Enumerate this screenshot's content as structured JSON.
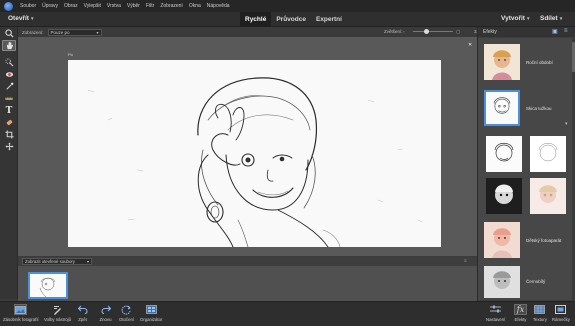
{
  "menubar": {
    "items": [
      "Soubor",
      "Úpravy",
      "Obraz",
      "Vylepšit",
      "Vrstva",
      "Výběr",
      "Filtr",
      "Zobrazení",
      "Okna",
      "Nápověda"
    ]
  },
  "modebar": {
    "open_label": "Otevřít",
    "modes": [
      "Rychlé",
      "Průvodce",
      "Expertní"
    ],
    "active_mode": "Rychlé",
    "create_label": "Vytvořit",
    "share_label": "Sdílet"
  },
  "options": {
    "view_label": "Zobrazení:",
    "view_value": "Pouze po",
    "zoom_label": "Zvětšení:",
    "zoom_value": "33%",
    "zoom_level": 0.3
  },
  "toolbox": {
    "tools": [
      "zoom-icon",
      "hand-icon",
      "quick-selection-icon",
      "red-eye-icon",
      "whiten-teeth-icon",
      "straighten-icon",
      "text-icon",
      "spot-healing-icon",
      "crop-icon",
      "move-icon"
    ],
    "active": "hand-icon"
  },
  "document": {
    "label": "Po",
    "close_glyph": "✕"
  },
  "photobin": {
    "select_value": "Zobrazit otevřené soubory"
  },
  "taskbar": {
    "left": [
      {
        "label": "Zásobník fotografií",
        "icon": "photo-bin-icon"
      },
      {
        "label": "Volby nástrojů",
        "icon": "tool-options-icon"
      },
      {
        "label": "Zpět",
        "icon": "undo-icon"
      },
      {
        "label": "Znovu",
        "icon": "redo-icon"
      },
      {
        "label": "Otočení",
        "icon": "rotate-icon"
      },
      {
        "label": "Organizátor",
        "icon": "organizer-icon"
      }
    ],
    "right": [
      {
        "label": "Nastavení",
        "icon": "adjustments-icon"
      },
      {
        "label": "Efekty",
        "icon": "effects-icon"
      },
      {
        "label": "Textury",
        "icon": "textures-icon"
      },
      {
        "label": "Rámečky",
        "icon": "frames-icon"
      }
    ]
  },
  "effects_panel": {
    "title": "Efekty",
    "items": [
      {
        "label": "Roční období"
      },
      {
        "label": "Skica tužkou",
        "selected": true
      },
      {
        "label": "Dětský fotoaparát"
      },
      {
        "label": "Černobílý"
      }
    ]
  },
  "colors": {
    "accent": "#4b8fdd",
    "menubar": "#262626",
    "panel": "#474747"
  }
}
